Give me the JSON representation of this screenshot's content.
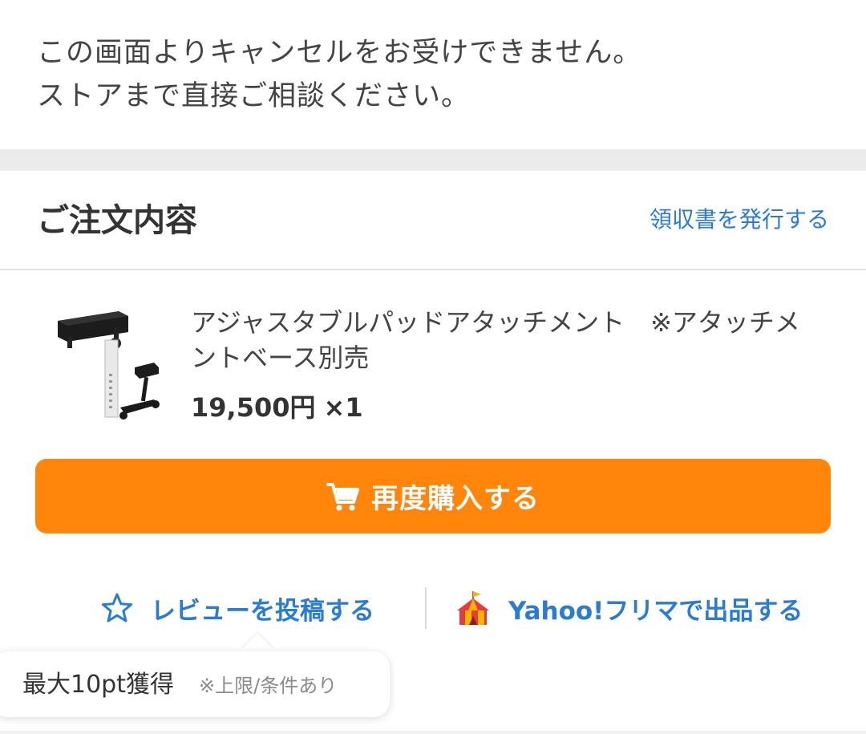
{
  "notice": {
    "line1": "この画面よりキャンセルをお受けできません。",
    "line2": "ストアまで直接ご相談ください。"
  },
  "order_section": {
    "title": "ご注文内容",
    "receipt_link": "領収書を発行する"
  },
  "item": {
    "name": "アジャスタブルパッドアタッチメント　※アタッチメントベース別売",
    "price": "19,500円",
    "quantity": "×1",
    "thumbnail_icon": "adjustable-pad-attachment-product-image"
  },
  "actions": {
    "rebuy_label": "再度購入する",
    "rebuy_icon": "cart-icon",
    "review_label": "レビューを投稿する",
    "review_icon": "star-outline-icon",
    "flea_label": "Yahoo!フリマで出品する",
    "flea_icon": "circus-tent-icon"
  },
  "tooltip": {
    "main": "最大10pt獲得",
    "note": "※上限/条件あり"
  },
  "colors": {
    "accent_orange": "#ff860b",
    "link_blue": "#2a7bd4",
    "section_gap": "#ebebeb"
  }
}
